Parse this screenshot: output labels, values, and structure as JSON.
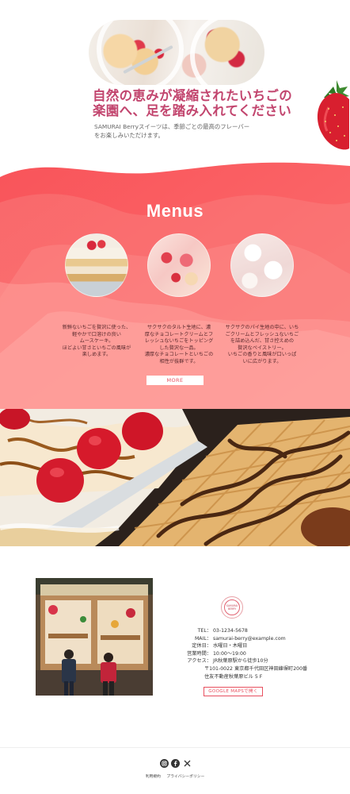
{
  "hero": {
    "title_line1": "自然の恵みが凝縮されたいちごの",
    "title_line2": "楽園へ、足を踏み入れてください",
    "subtitle_line1": "SAMURAI Berryスイーツは、季節ごとの最高のフレーバー",
    "subtitle_line2": "をお楽しみいただけます。"
  },
  "menus": {
    "title": "Menus",
    "items": [
      {
        "lines": [
          "新鮮ないちごを贅沢に使った、",
          "軽やかで口溶けの良い",
          "ムースケーキ。",
          "ほどよい甘さといちごの風味が",
          "楽しめます。"
        ]
      },
      {
        "lines": [
          "サクサクのタルト生地に、濃",
          "厚なチョコレートクリームとフ",
          "レッシュないちごをトッピング",
          "した贅沢な一品。",
          "濃厚なチョコレートといちごの",
          "相性が抜群です。"
        ]
      },
      {
        "lines": [
          "サクサクのパイ生地の中に、いち",
          "ごクリームとフレッシュないちご",
          "を詰め込んだ、甘さ控えめの",
          "贅沢なペイストリー。",
          "いちごの香りと風味が口いっぱ",
          "いに広がります。"
        ]
      }
    ],
    "more_label": "MORE"
  },
  "shop": {
    "logo_line1": "SAMURAI",
    "logo_line2": "BERRY",
    "tel_label": "TEL：",
    "tel": "03-1234-5678",
    "mail_label": "MAIL：",
    "mail": "samurai-berry@example.com",
    "closed_label": "定休日：",
    "closed": "水曜日・木曜日",
    "hours_label": "営業時間：",
    "hours": "10:00〜19:00",
    "access_label": "アクセス：",
    "access": "JR秋葉原駅から徒歩10分",
    "address1": "〒101-0022 東京都千代田区神田練塀町200番",
    "address2": "住友不動産秋葉原ビル 5 F",
    "map_button": "GOOGLE MAPSで開く"
  },
  "footer": {
    "social_icons": [
      "instagram-icon",
      "facebook-icon",
      "x-icon"
    ],
    "link1": "利用規約",
    "link2": "プライバシーポリシー"
  },
  "colors": {
    "accent": "#e8505f",
    "title_pink": "#c2456e",
    "menus_bg": "#fa6f6f"
  }
}
